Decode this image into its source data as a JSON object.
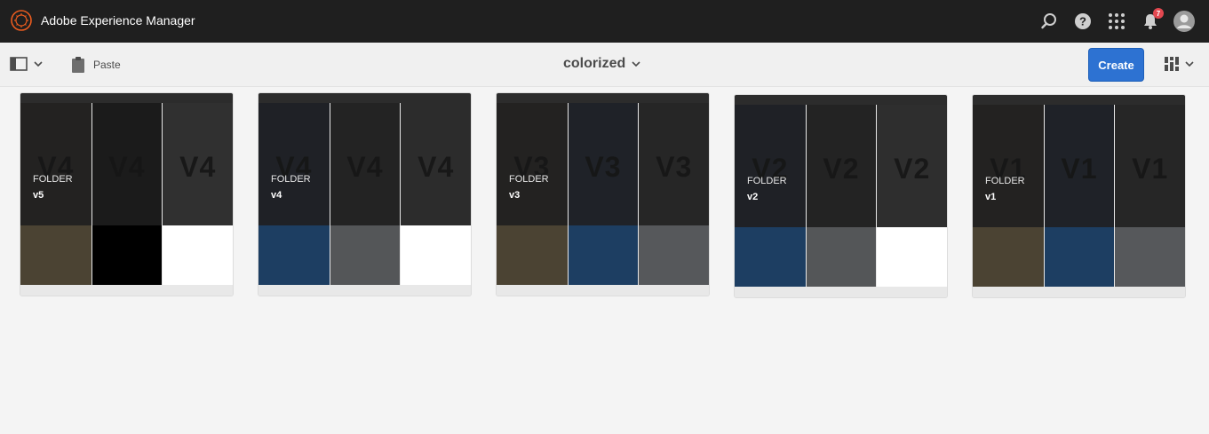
{
  "header": {
    "title": "Adobe Experience Manager",
    "notification_count": "7",
    "icons": [
      "search-icon",
      "help-icon",
      "app-grid-icon",
      "bell-icon",
      "user-avatar"
    ]
  },
  "actionbar": {
    "paste_label": "Paste",
    "folder_title": "colorized",
    "create_label": "Create"
  },
  "colors": {
    "header_bg": "#1f1f1f",
    "accent": "#2d72d2",
    "brand_orange": "#eb5c1f"
  },
  "cards": [
    {
      "type": "FOLDER",
      "name": "v5",
      "thumbs": [
        "V4",
        "V4",
        "V4"
      ],
      "thumb_bg": [
        "#232221",
        "#1b1b1b",
        "#303030"
      ],
      "swatches": [
        "#4b4333",
        "#000000",
        "#ffffff"
      ]
    },
    {
      "type": "FOLDER",
      "name": "v4",
      "thumbs": [
        "V4",
        "V4",
        "V4"
      ],
      "thumb_bg": [
        "#1f2126",
        "#232323",
        "#2c2c2c"
      ],
      "swatches": [
        "#1d3e62",
        "#545658",
        "#ffffff"
      ]
    },
    {
      "type": "FOLDER",
      "name": "v3",
      "thumbs": [
        "V3",
        "V3",
        "V3"
      ],
      "thumb_bg": [
        "#232221",
        "#1f2228",
        "#262626"
      ],
      "swatches": [
        "#4b4333",
        "#1d3e62",
        "#56585b"
      ]
    },
    {
      "type": "FOLDER",
      "name": "v2",
      "thumbs": [
        "V2",
        "V2",
        "V2"
      ],
      "thumb_bg": [
        "#1f2126",
        "#232323",
        "#2e2e2e"
      ],
      "swatches": [
        "#1d3e62",
        "#545658",
        "#ffffff"
      ]
    },
    {
      "type": "FOLDER",
      "name": "v1",
      "thumbs": [
        "V1",
        "V1",
        "V1"
      ],
      "thumb_bg": [
        "#232221",
        "#1f2228",
        "#262626"
      ],
      "swatches": [
        "#4b4333",
        "#1d3e62",
        "#56585b"
      ]
    }
  ]
}
